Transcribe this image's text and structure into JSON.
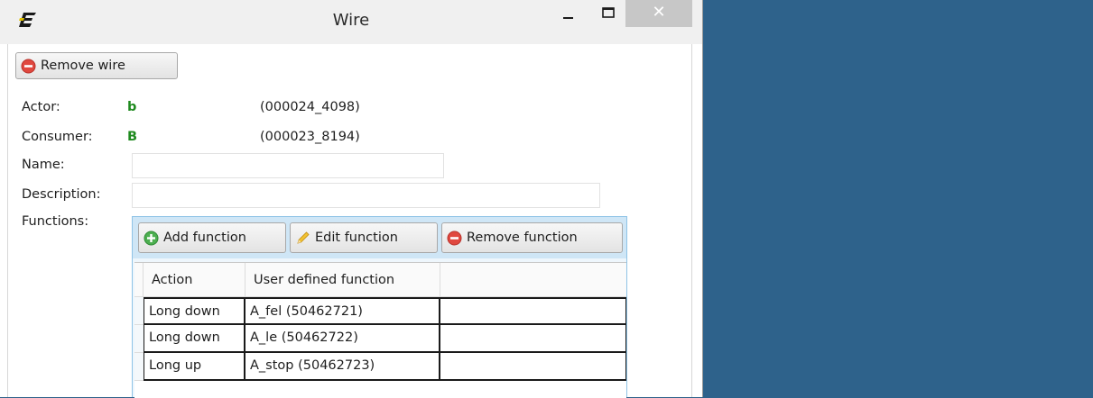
{
  "window": {
    "title": "Wire",
    "minimize_glyph": "–",
    "maximize_glyph": "☐",
    "close_glyph": "✕",
    "app_icon": "app-logo-icon"
  },
  "toolbar": {
    "remove_wire_label": "Remove wire",
    "remove_icon": "remove-circle-icon"
  },
  "details": {
    "actor_label": "Actor:",
    "actor_value": "b",
    "actor_id": "(000024_4098)",
    "consumer_label": "Consumer:",
    "consumer_value": "B",
    "consumer_id": "(000023_8194)",
    "name_label": "Name:",
    "name_value": "",
    "description_label": "Description:",
    "description_value": "",
    "functions_label": "Functions:"
  },
  "functions": {
    "add_label": "Add function",
    "edit_label": "Edit function",
    "remove_label": "Remove function",
    "columns": [
      "Action",
      "User defined function"
    ],
    "rows": [
      {
        "action": "Long down",
        "function": "A_fel (50462721)"
      },
      {
        "action": "Long down",
        "function": "A_le (50462722)"
      },
      {
        "action": "Long up",
        "function": "A_stop (50462723)"
      }
    ]
  },
  "colors": {
    "desktop": "#2e628b",
    "value_green": "#1f8a1f",
    "remove_red": "#e0483f",
    "add_green": "#4caf50",
    "panel_blue": "#cfe6f6"
  }
}
